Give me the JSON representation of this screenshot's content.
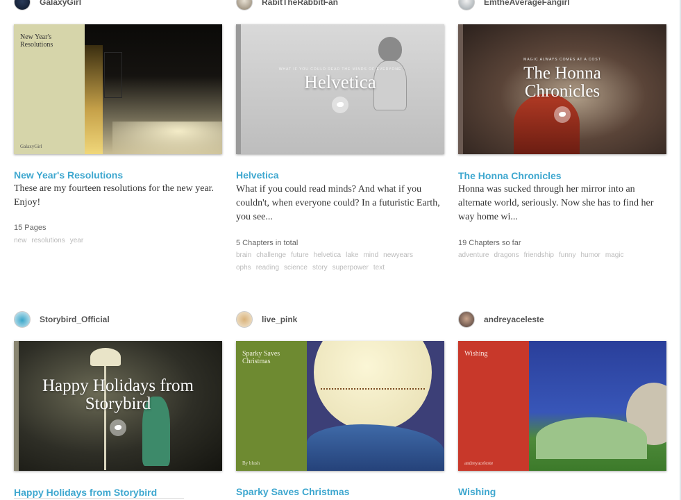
{
  "cards": [
    {
      "author": "GalaxyGirl",
      "title": "New Year's Resolutions",
      "desc": "These are my fourteen resolutions for the new year. Enjoy!",
      "meta": "15 Pages",
      "tags": [
        "new",
        "resolutions",
        "year"
      ],
      "cover_title": "New Year's Resolutions",
      "cover_byline": "GalaxyGirl"
    },
    {
      "author": "RabitTheRabbitFan",
      "title": "Helvetica",
      "desc": "What if you could read minds? And what if you couldn't, when everyone could? In a futuristic Earth, you see...",
      "meta": "5 Chapters in total",
      "tags": [
        "brain",
        "challenge",
        "future",
        "helvetica",
        "lake",
        "mind",
        "newyears",
        "ophs",
        "reading",
        "science",
        "story",
        "superpower",
        "text"
      ],
      "cover_title": "Helvetica",
      "cover_kicker": "WHAT IF YOU COULD READ THE MINDS OF EVERYONE"
    },
    {
      "author": "EmtheAverageFangirl",
      "title": "The Honna Chronicles",
      "desc": "Honna was sucked through her mirror into an alternate world, seriously. Now she has to find her way home wi...",
      "meta": "19 Chapters so far",
      "tags": [
        "adventure",
        "dragons",
        "friendship",
        "funny",
        "humor",
        "magic"
      ],
      "cover_title": "The Honna Chronicles",
      "cover_kicker": "MAGIC ALWAYS COMES AT A COST"
    },
    {
      "author": "Storybird_Official",
      "title": "Happy Holidays from Storybird",
      "cover_title": "Happy Holidays from Storybird"
    },
    {
      "author": "live_pink",
      "title": "Sparky Saves Christmas",
      "cover_title": "Sparky Saves Christmas",
      "cover_byline": "By blush"
    },
    {
      "author": "andreyaceleste",
      "title": "Wishing",
      "cover_title": "Wishing",
      "cover_byline": "andreyaceleste"
    }
  ]
}
